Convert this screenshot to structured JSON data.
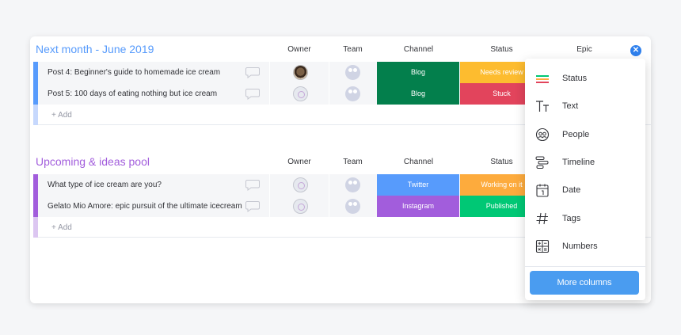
{
  "columns": {
    "owner": "Owner",
    "team": "Team",
    "channel": "Channel",
    "status": "Status",
    "epic": "Epic"
  },
  "groups": [
    {
      "title": "Next month - June 2019",
      "color": "#579bfc",
      "add_label": "+ Add",
      "rows": [
        {
          "name": "Post 4: Beginner's guide to homemade ice cream",
          "channel": "Blog",
          "channel_color": "#037f4c",
          "status": "Needs review",
          "status_color": "#fdbc2f"
        },
        {
          "name": "Post 5: 100 days of eating nothing but ice cream",
          "channel": "Blog",
          "channel_color": "#037f4c",
          "status": "Stuck",
          "status_color": "#e2445c"
        }
      ]
    },
    {
      "title": "Upcoming & ideas pool",
      "color": "#a25ddc",
      "add_label": "+ Add",
      "rows": [
        {
          "name": "What type of ice cream are you?",
          "channel": "Twitter",
          "channel_color": "#579bfc",
          "status": "Working on it",
          "status_color": "#fdab3d"
        },
        {
          "name": "Gelato Mio Amore: epic pursuit of the ultimate icecream",
          "channel": "Instagram",
          "channel_color": "#a25ddc",
          "status": "Published",
          "status_color": "#00c875"
        }
      ]
    }
  ],
  "menu": {
    "items": [
      {
        "label": "Status",
        "icon": "status-icon"
      },
      {
        "label": "Text",
        "icon": "text-icon"
      },
      {
        "label": "People",
        "icon": "people-icon"
      },
      {
        "label": "Timeline",
        "icon": "timeline-icon"
      },
      {
        "label": "Date",
        "icon": "date-icon"
      },
      {
        "label": "Tags",
        "icon": "tags-icon"
      },
      {
        "label": "Numbers",
        "icon": "numbers-icon"
      }
    ],
    "more_label": "More columns"
  },
  "close_icon": "close-icon",
  "accent": "#4a9cf0"
}
